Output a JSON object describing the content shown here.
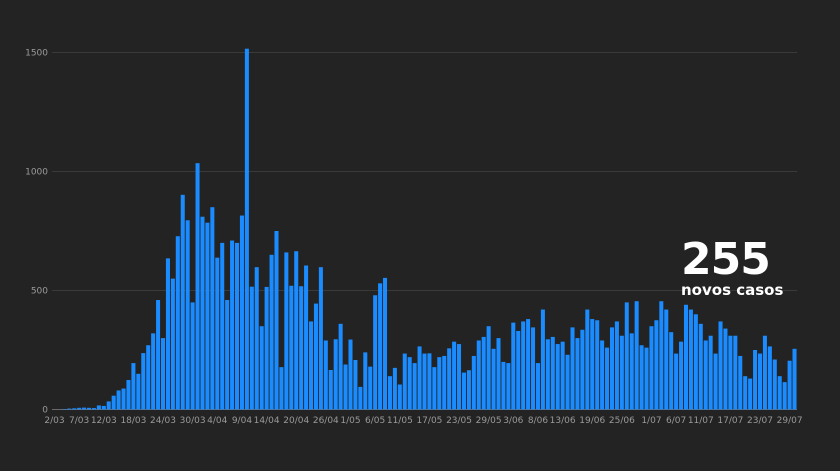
{
  "chart_data": {
    "type": "bar",
    "title": "",
    "xlabel": "",
    "ylabel": "",
    "ylim": [
      0,
      1600
    ],
    "yticks": [
      0,
      500,
      1000,
      1500
    ],
    "grid": true,
    "start_date": "2/03",
    "x_tick_labels": [
      "2/03",
      "7/03",
      "12/03",
      "18/03",
      "24/03",
      "30/03",
      "4/04",
      "9/04",
      "14/04",
      "20/04",
      "26/04",
      "1/05",
      "6/05",
      "11/05",
      "17/05",
      "23/05",
      "29/05",
      "3/06",
      "8/06",
      "13/06",
      "19/06",
      "25/06",
      "1/07",
      "6/07",
      "11/07",
      "17/07",
      "23/07",
      "29/07"
    ],
    "x_tick_day_index": [
      0,
      5,
      10,
      16,
      22,
      28,
      33,
      38,
      43,
      49,
      55,
      60,
      65,
      70,
      76,
      82,
      88,
      93,
      98,
      103,
      109,
      115,
      121,
      126,
      131,
      137,
      143,
      149
    ],
    "bar_color": "#1a8cff",
    "values": [
      0,
      0,
      2,
      4,
      5,
      7,
      8,
      7,
      6,
      17,
      15,
      34,
      58,
      80,
      88,
      124,
      195,
      150,
      237,
      270,
      320,
      460,
      300,
      635,
      550,
      728,
      902,
      795,
      450,
      1035,
      810,
      785,
      850,
      638,
      700,
      460,
      710,
      700,
      815,
      1516,
      516,
      598,
      350,
      515,
      650,
      750,
      178,
      660,
      520,
      665,
      518,
      605,
      370,
      445,
      598,
      290,
      166,
      295,
      360,
      189,
      294,
      208,
      95,
      240,
      180,
      480,
      530,
      553,
      140,
      175,
      105,
      235,
      220,
      195,
      265,
      235,
      236,
      178,
      220,
      225,
      257,
      285,
      275,
      155,
      165,
      225,
      290,
      305,
      350,
      255,
      300,
      200,
      195,
      365,
      330,
      370,
      380,
      345,
      195,
      420,
      295,
      305,
      275,
      285,
      230,
      345,
      300,
      335,
      420,
      380,
      375,
      290,
      260,
      345,
      370,
      310,
      450,
      320,
      455,
      270,
      260,
      350,
      375,
      455,
      420,
      325,
      235,
      285,
      440,
      420,
      400,
      360,
      290,
      310,
      235,
      370,
      340,
      310,
      310,
      225,
      140,
      130,
      250,
      235,
      310,
      265,
      210,
      140,
      115,
      205,
      255
    ]
  },
  "callout": {
    "number": "255",
    "label": "novos casos"
  }
}
